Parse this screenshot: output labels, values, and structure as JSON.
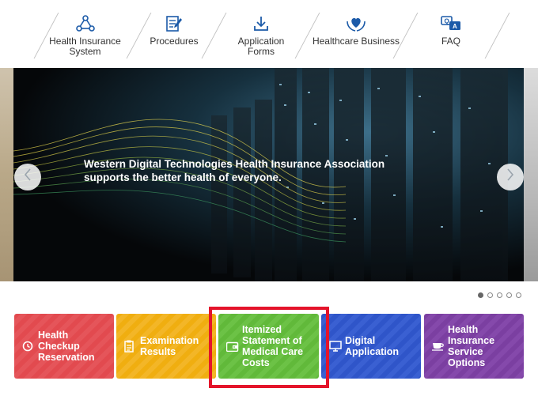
{
  "nav": {
    "items": [
      {
        "label": "Health Insurance System",
        "icon": "network-nodes-icon"
      },
      {
        "label": "Procedures",
        "icon": "document-edit-icon"
      },
      {
        "label": "Application Forms",
        "icon": "download-icon"
      },
      {
        "label": "Healthcare Business",
        "icon": "heart-hands-icon"
      },
      {
        "label": "FAQ",
        "icon": "qa-chat-icon"
      }
    ]
  },
  "hero": {
    "caption_line1": "Western Digital Technologies Health Insurance Association",
    "caption_line2": "supports the better health of everyone.",
    "prev_icon": "chevron-left-icon",
    "next_icon": "chevron-right-icon",
    "slide_count": 5,
    "active_slide": 1
  },
  "tiles": [
    {
      "label": "Health Checkup Reservation",
      "icon": "clock-icon",
      "color": "#e24a4f"
    },
    {
      "label": "Examination Results",
      "icon": "clipboard-icon",
      "color": "#f0ae10"
    },
    {
      "label": "Itemized Statement of Medical Care Costs",
      "icon": "wallet-icon",
      "color": "#61b93a"
    },
    {
      "label": "Digital Application",
      "icon": "monitor-icon",
      "color": "#2f55c9"
    },
    {
      "label": "Health Insurance Service Options",
      "icon": "teacup-icon",
      "color": "#7b3fa1"
    }
  ],
  "colors": {
    "nav_icon": "#1b5aa8",
    "highlight": "#e4142b"
  }
}
